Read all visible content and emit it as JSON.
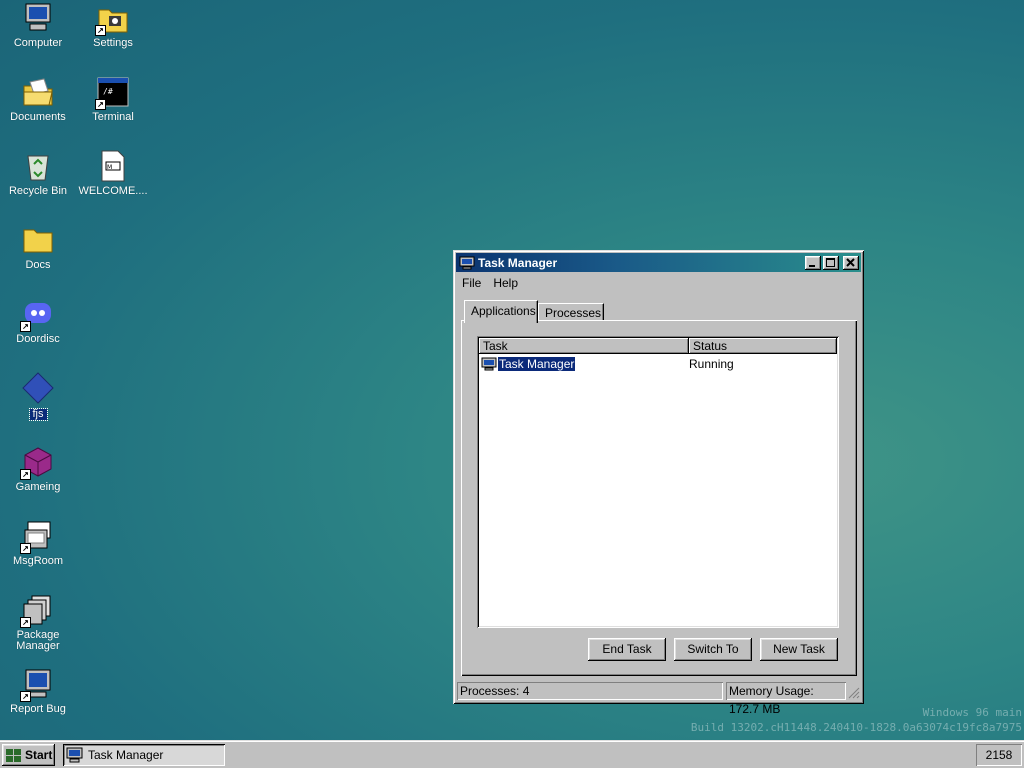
{
  "desktop": {
    "icons": [
      {
        "label": "Computer",
        "icon": "computer-icon"
      },
      {
        "label": "Settings",
        "icon": "settings-icon"
      },
      {
        "label": "Documents",
        "icon": "folder-open-icon"
      },
      {
        "label": "Terminal",
        "icon": "terminal-icon"
      },
      {
        "label": "Recycle Bin",
        "icon": "recycle-bin-icon"
      },
      {
        "label": "WELCOME....",
        "icon": "markdown-file-icon"
      },
      {
        "label": "Docs",
        "icon": "folder-icon"
      },
      {
        "label": "Doordisc",
        "icon": "doordisc-icon"
      },
      {
        "label": "fjs",
        "icon": "diamond-icon"
      },
      {
        "label": "Gameing",
        "icon": "cube-icon"
      },
      {
        "label": "MsgRoom",
        "icon": "msgroom-icon"
      },
      {
        "label": "Package Manager",
        "icon": "package-icon"
      },
      {
        "label": "Report Bug",
        "icon": "report-bug-icon"
      }
    ],
    "watermark": {
      "line1": "Windows 96 main",
      "line2": "Build 13202.cH11448.240410-1828.0a63074c19fc8a7975"
    }
  },
  "window": {
    "title": "Task Manager",
    "menu": [
      "File",
      "Help"
    ],
    "tabs": [
      "Applications",
      "Processes"
    ],
    "active_tab": "Applications",
    "columns": [
      "Task",
      "Status"
    ],
    "rows": [
      {
        "task": "Task Manager",
        "status": "Running"
      }
    ],
    "buttons": {
      "end_task": "End Task",
      "switch_to": "Switch To",
      "new_task": "New Task"
    },
    "status": {
      "processes": "Processes: 4",
      "memory": "Memory Usage: 172.7 MB"
    }
  },
  "taskbar": {
    "start_label": "Start",
    "task_button": "Task Manager",
    "clock": "2158"
  }
}
